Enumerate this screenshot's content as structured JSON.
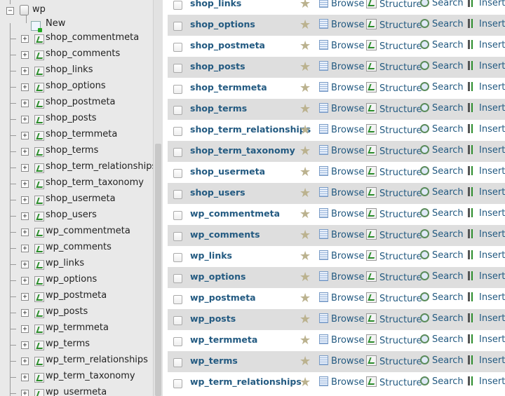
{
  "nav": {
    "database": {
      "label": "wp",
      "expander": "−"
    },
    "new_item": {
      "label": "New"
    },
    "tables": [
      "shop_commentmeta",
      "shop_comments",
      "shop_links",
      "shop_options",
      "shop_postmeta",
      "shop_posts",
      "shop_termmeta",
      "shop_terms",
      "shop_term_relationships",
      "shop_term_taxonomy",
      "shop_usermeta",
      "shop_users",
      "wp_commentmeta",
      "wp_comments",
      "wp_links",
      "wp_options",
      "wp_postmeta",
      "wp_posts",
      "wp_termmeta",
      "wp_terms",
      "wp_term_relationships",
      "wp_term_taxonomy",
      "wp_usermeta"
    ],
    "table_expander": "+"
  },
  "main": {
    "actions": {
      "star": "★",
      "browse": "Browse",
      "structure": "Structure",
      "search": "Search",
      "insert": "Insert"
    },
    "rows": [
      "shop_links",
      "shop_options",
      "shop_postmeta",
      "shop_posts",
      "shop_termmeta",
      "shop_terms",
      "shop_term_relationships",
      "shop_term_taxonomy",
      "shop_usermeta",
      "shop_users",
      "wp_commentmeta",
      "wp_comments",
      "wp_links",
      "wp_options",
      "wp_postmeta",
      "wp_posts",
      "wp_termmeta",
      "wp_terms",
      "wp_term_relationships"
    ]
  },
  "colors": {
    "link": "#235a81",
    "row_alt": "#dedede",
    "nav_bg": "#e9e9e9",
    "star": "#bbb28f"
  }
}
